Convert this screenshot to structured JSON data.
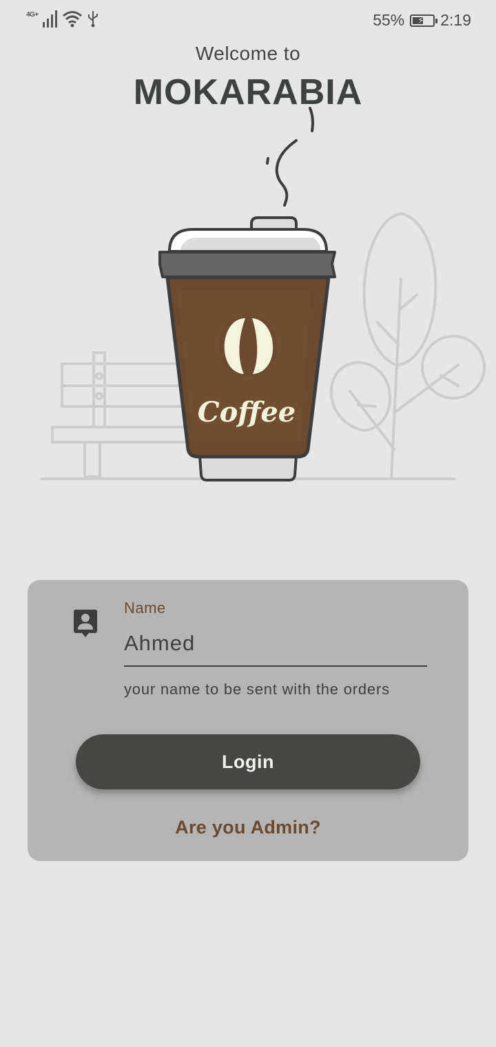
{
  "status_bar": {
    "network_label": "4G+",
    "battery_percent": "55%",
    "battery_level": 0.55,
    "time": "2:19"
  },
  "header": {
    "welcome": "Welcome to",
    "brand": "MOKARABIA"
  },
  "illustration": {
    "cup_label": "Coffee",
    "colors": {
      "coffee": "#6b4a30",
      "lid": "#666666",
      "bean": "#f4f4dc",
      "outline": "#3d3d3d"
    }
  },
  "login_card": {
    "field_label": "Name",
    "field_value": "Ahmed",
    "helper_text": "your name to be sent with the orders",
    "login_button": "Login",
    "admin_link": "Are you Admin?",
    "colors": {
      "card": "#b5b5b5",
      "button": "#474742",
      "accent": "#6b4a30"
    }
  }
}
